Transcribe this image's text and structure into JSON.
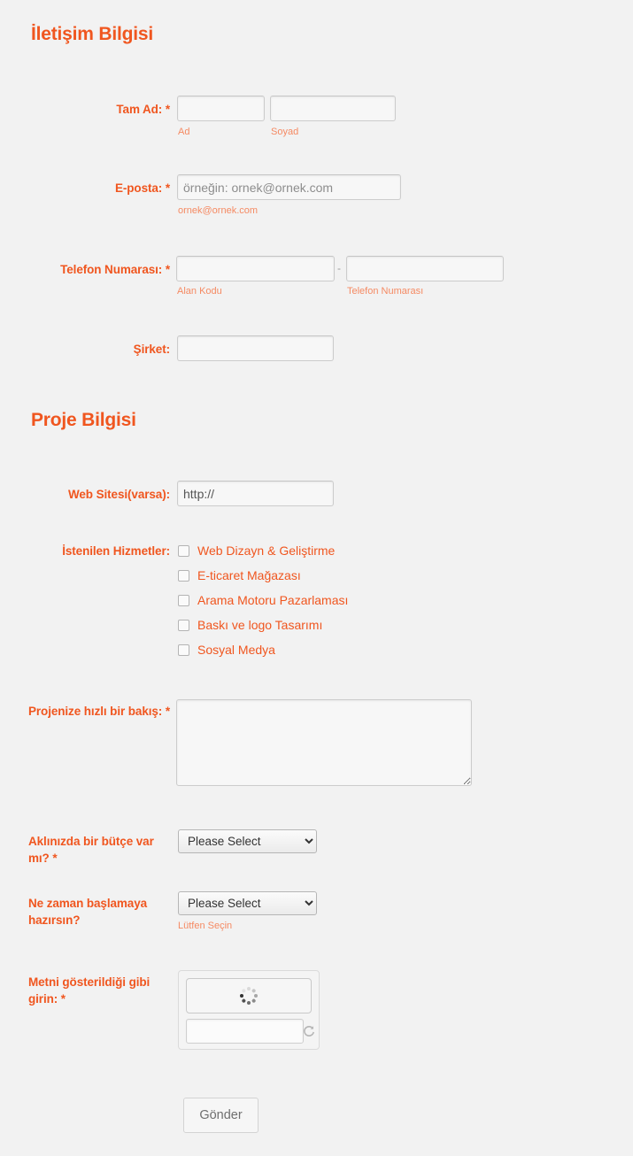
{
  "sections": {
    "contact_heading": "İletişim Bilgisi",
    "project_heading": "Proje Bilgisi"
  },
  "fields": {
    "full_name": {
      "label": "Tam Ad: *",
      "first": {
        "value": "",
        "sublabel": "Ad"
      },
      "last": {
        "value": "",
        "sublabel": "Soyad"
      }
    },
    "email": {
      "label": "E-posta: *",
      "placeholder": "örneğin: ornek@ornek.com",
      "value": "",
      "sublabel": "ornek@ornek.com"
    },
    "phone": {
      "label": "Telefon Numarası: *",
      "separator": "-",
      "area": {
        "value": "",
        "sublabel": "Alan Kodu"
      },
      "number": {
        "value": "",
        "sublabel": "Telefon Numarası"
      }
    },
    "company": {
      "label": "Şirket:",
      "value": ""
    },
    "website": {
      "label": "Web Sitesi(varsa):",
      "value": "http://"
    },
    "services": {
      "label": "İstenilen Hizmetler:",
      "options": [
        "Web Dizayn & Geliştirme",
        "E-ticaret Mağazası",
        "Arama Motoru Pazarlaması",
        "Baskı ve logo Tasarımı",
        "Sosyal Medya"
      ]
    },
    "overview": {
      "label": "Projenize hızlı bir bakış: *",
      "value": ""
    },
    "budget": {
      "label": "Aklınızda bir bütçe var mı? *",
      "selected": "Please Select"
    },
    "start_time": {
      "label": "Ne zaman başlamaya hazırsın?",
      "selected": "Please Select",
      "sublabel": "Lütfen Seçin"
    },
    "captcha": {
      "label": "Metni gösterildiği gibi girin:  *",
      "value": "",
      "image_state": "loading-spinner",
      "reload_icon": "refresh-icon"
    }
  },
  "actions": {
    "submit_label": "Gönder"
  },
  "colors": {
    "accent": "#f0561f",
    "sublabel": "#f58a63",
    "background": "#f2f2f2"
  }
}
